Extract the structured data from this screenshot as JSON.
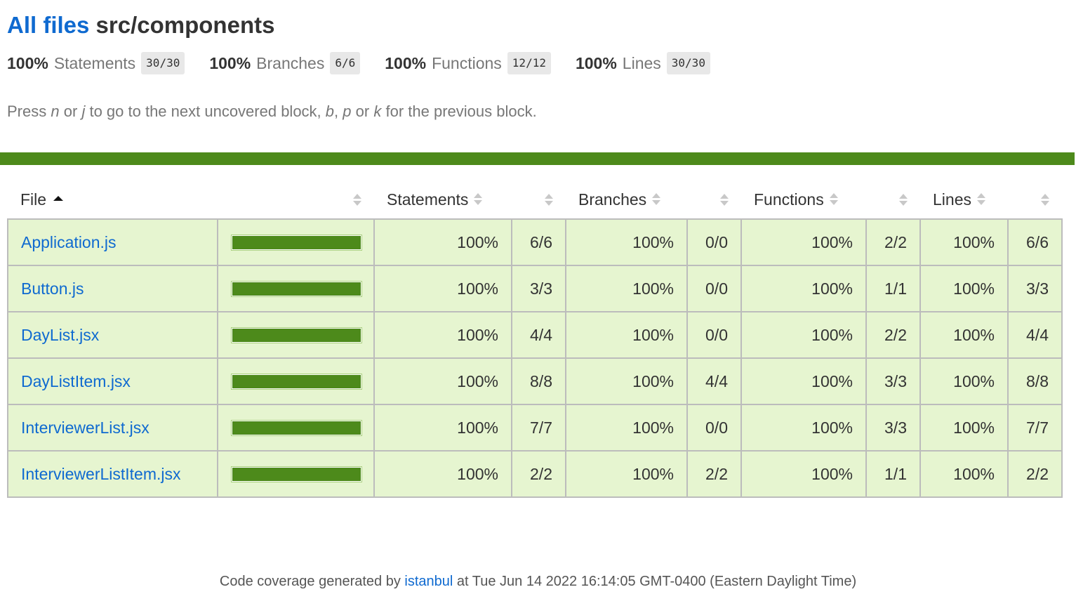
{
  "header": {
    "all_files_link": "All files",
    "path": "src/components"
  },
  "summary": [
    {
      "pct": "100%",
      "label": "Statements",
      "fraction": "30/30"
    },
    {
      "pct": "100%",
      "label": "Branches",
      "fraction": "6/6"
    },
    {
      "pct": "100%",
      "label": "Functions",
      "fraction": "12/12"
    },
    {
      "pct": "100%",
      "label": "Lines",
      "fraction": "30/30"
    }
  ],
  "hint": {
    "press": "Press",
    "n": "n",
    "or1": "or",
    "j": "j",
    "mid": "to go to the next uncovered block,",
    "b": "b",
    "comma": ",",
    "p": "p",
    "or2": "or",
    "k": "k",
    "end": "for the previous block."
  },
  "colors": {
    "accent_link": "#0f6ad0",
    "status_high": "#4d8a1b",
    "row_high_bg": "#e6f5d0"
  },
  "table": {
    "headers": {
      "file": "File",
      "statements": "Statements",
      "branches": "Branches",
      "functions": "Functions",
      "lines": "Lines"
    },
    "sort": {
      "column": "File",
      "direction": "ascending"
    },
    "rows": [
      {
        "file": "Application.js",
        "coverage": 1.0,
        "stmt_pct": "100%",
        "stmt_frac": "6/6",
        "br_pct": "100%",
        "br_frac": "0/0",
        "fn_pct": "100%",
        "fn_frac": "2/2",
        "ln_pct": "100%",
        "ln_frac": "6/6"
      },
      {
        "file": "Button.js",
        "coverage": 1.0,
        "stmt_pct": "100%",
        "stmt_frac": "3/3",
        "br_pct": "100%",
        "br_frac": "0/0",
        "fn_pct": "100%",
        "fn_frac": "1/1",
        "ln_pct": "100%",
        "ln_frac": "3/3"
      },
      {
        "file": "DayList.jsx",
        "coverage": 1.0,
        "stmt_pct": "100%",
        "stmt_frac": "4/4",
        "br_pct": "100%",
        "br_frac": "0/0",
        "fn_pct": "100%",
        "fn_frac": "2/2",
        "ln_pct": "100%",
        "ln_frac": "4/4"
      },
      {
        "file": "DayListItem.jsx",
        "coverage": 1.0,
        "stmt_pct": "100%",
        "stmt_frac": "8/8",
        "br_pct": "100%",
        "br_frac": "4/4",
        "fn_pct": "100%",
        "fn_frac": "3/3",
        "ln_pct": "100%",
        "ln_frac": "8/8"
      },
      {
        "file": "InterviewerList.jsx",
        "coverage": 1.0,
        "stmt_pct": "100%",
        "stmt_frac": "7/7",
        "br_pct": "100%",
        "br_frac": "0/0",
        "fn_pct": "100%",
        "fn_frac": "3/3",
        "ln_pct": "100%",
        "ln_frac": "7/7"
      },
      {
        "file": "InterviewerListItem.jsx",
        "coverage": 1.0,
        "stmt_pct": "100%",
        "stmt_frac": "2/2",
        "br_pct": "100%",
        "br_frac": "2/2",
        "fn_pct": "100%",
        "fn_frac": "1/1",
        "ln_pct": "100%",
        "ln_frac": "2/2"
      }
    ]
  },
  "footer": {
    "prefix": "Code coverage generated by",
    "link": "istanbul",
    "suffix": "at Tue Jun 14 2022 16:14:05 GMT-0400 (Eastern Daylight Time)"
  }
}
